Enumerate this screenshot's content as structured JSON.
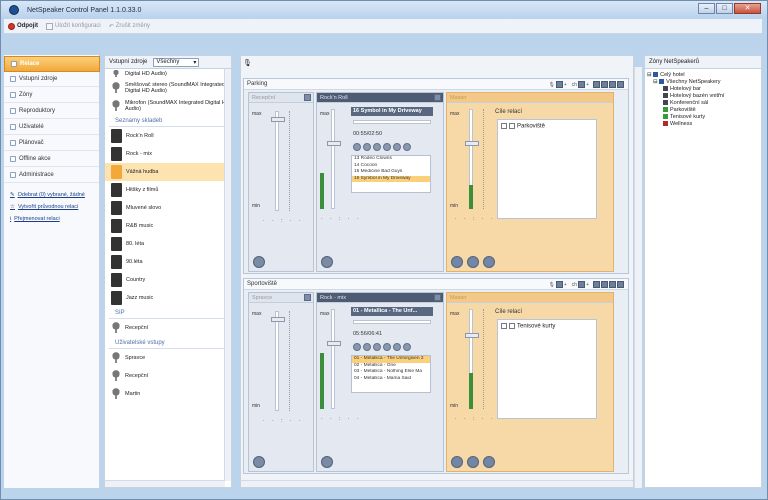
{
  "window": {
    "title": "NetSpeaker Control Panel 1.1.0.33.0"
  },
  "toolbar": {
    "disconnect": "Odpojit",
    "save": "Uložit konfiguraci",
    "undo": "Zrušit změny"
  },
  "nav": {
    "items": [
      "Relace",
      "Vstupní zdroje",
      "Zóny",
      "Reproduktory",
      "Uživatelé",
      "Plánovač",
      "Offline akce",
      "Administrace"
    ],
    "links": [
      "Odebrat (0) vybrané, žádné",
      "Vytvořit průvodnou relaci",
      "Přejmenovat relaci"
    ]
  },
  "sources": {
    "header": "Vstupní zdroje",
    "filter": "Všechny",
    "items_top": [
      "Digital HD Audio)",
      "Směšovač stereo (SoundMAX Integrated Digital HD Audio)",
      "Mikrofon (SoundMAX Integrated Digital HD Audio)"
    ],
    "section1": "Seznamy skladeb",
    "playlists": [
      "Rock'n Roll",
      "Rock - mix",
      "Vážná hudba",
      "Hitšky z filmů",
      "Mluvené slovo",
      "R&B music",
      "80. léta",
      "90.léta",
      "Country",
      "Jazz music"
    ],
    "section2": "SIP",
    "sip": [
      "Recepční"
    ],
    "section3": "Uživatelské vstupy",
    "users": [
      "Spravce",
      "Recepční",
      "Martin"
    ]
  },
  "zones": [
    {
      "name": "Parking",
      "ch_label": "ch",
      "col1": "Recepční",
      "col2": "Rock'n Roll",
      "col3": "Master",
      "title": "16 Symbol in My Driveway",
      "time": "00:55/02:50",
      "playlist": [
        "13 Rodeo Clowns",
        "14 Cocoon",
        "15 Medicine Bad Guys",
        "16 Symbol in My Driveway"
      ],
      "target_label": "Cíle relací",
      "target": "Parkoviště",
      "max": "max",
      "min": "min"
    },
    {
      "name": "Sportoviště",
      "ch_label": "ch",
      "col1": "Spravce",
      "col2": "Rock - mix",
      "col3": "Master",
      "title": "01 - Metallica - The Unf...",
      "time": "05:56/06:41",
      "playlist": [
        "01 - Metallica - The Unforgiven 2",
        "02 - Metallica - One",
        "03 - Metallica - Nothing Else Ma",
        "04 - Metallica - Mama Said"
      ],
      "target_label": "Cíle relací",
      "target": "Tenisové kurty",
      "max": "max",
      "min": "min"
    }
  ],
  "zones_panel": {
    "header": "Zóny NetSpeakerů",
    "tree": [
      "Celý hotel",
      "Všechny NetSpeakery",
      "Hotelový bar",
      "Hotelový bazén vnitřní",
      "Konferenční sál",
      "Parkoviště",
      "Tenisové kurty",
      "Wellness"
    ]
  },
  "colors": {
    "accent": "#f3a83a",
    "title_bar": "#b9d1ec",
    "dark": "#4d5b73"
  }
}
